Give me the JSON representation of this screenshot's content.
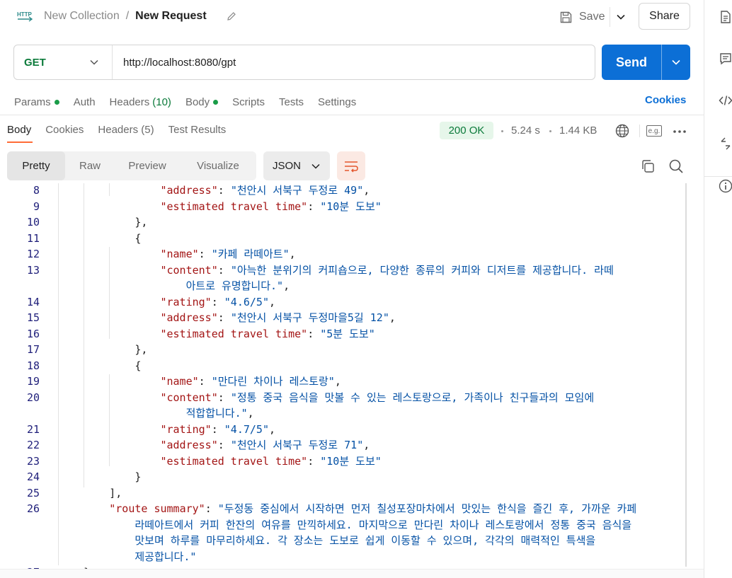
{
  "header": {
    "collection": "New Collection",
    "separator": "/",
    "request_name": "New Request",
    "save_label": "Save",
    "share_label": "Share"
  },
  "request": {
    "method": "GET",
    "url": "http://localhost:8080/gpt",
    "send_label": "Send"
  },
  "request_tabs": [
    {
      "label": "Params",
      "dot": true
    },
    {
      "label": "Auth"
    },
    {
      "label": "Headers",
      "count": "(10)"
    },
    {
      "label": "Body",
      "dot": true
    },
    {
      "label": "Scripts"
    },
    {
      "label": "Tests"
    },
    {
      "label": "Settings"
    }
  ],
  "cookies_link": "Cookies",
  "response": {
    "tabs": [
      {
        "label": "Body",
        "active": true
      },
      {
        "label": "Cookies"
      },
      {
        "label": "Headers (5)"
      },
      {
        "label": "Test Results"
      }
    ],
    "status": "200 OK",
    "time": "5.24 s",
    "size": "1.44 KB",
    "example_icon_text": "e.g."
  },
  "format": {
    "modes": [
      "Pretty",
      "Raw",
      "Preview",
      "Visualize"
    ],
    "active_mode": "Pretty",
    "language": "JSON"
  },
  "icons": {
    "http": "http-icon",
    "edit": "pencil-icon",
    "save": "save-icon",
    "wrap": "wrap-lines-icon",
    "copy": "copy-icon",
    "search": "search-icon",
    "globe": "globe-icon",
    "more": "more-icon",
    "rail": [
      "documentation-icon",
      "comments-icon",
      "code-icon",
      "related-icon",
      "info-icon"
    ]
  },
  "colors": {
    "send": "#0c6fd6",
    "method": "#0b7a3a",
    "status_bg": "#e6f6ea",
    "tab_accent": "#ff6c37",
    "json_key": "#a31515",
    "json_string": "#0451a5"
  },
  "code_lines": [
    {
      "n": "8",
      "indent": 5,
      "segs": [
        [
          "k",
          "\"address\""
        ],
        [
          "p",
          ": "
        ],
        [
          "s",
          "\"천안시 서북구 두정로 49\""
        ],
        [
          "p",
          ","
        ]
      ]
    },
    {
      "n": "9",
      "indent": 5,
      "segs": [
        [
          "k",
          "\"estimated travel time\""
        ],
        [
          "p",
          ": "
        ],
        [
          "s",
          "\"10분 도보\""
        ]
      ]
    },
    {
      "n": "10",
      "indent": 4,
      "segs": [
        [
          "p",
          "},"
        ]
      ]
    },
    {
      "n": "11",
      "indent": 4,
      "segs": [
        [
          "p",
          "{"
        ]
      ]
    },
    {
      "n": "12",
      "indent": 5,
      "segs": [
        [
          "k",
          "\"name\""
        ],
        [
          "p",
          ": "
        ],
        [
          "s",
          "\"카페 라떼아트\""
        ],
        [
          "p",
          ","
        ]
      ]
    },
    {
      "n": "13",
      "indent": 5,
      "segs": [
        [
          "k",
          "\"content\""
        ],
        [
          "p",
          ": "
        ],
        [
          "s",
          "\"아늑한 분위기의 커피숍으로, 다양한 종류의 커피와 디저트를 제공합니다. 라떼"
        ]
      ]
    },
    {
      "n": "",
      "indent": 6,
      "segs": [
        [
          "s",
          "아트로 유명합니다.\""
        ],
        [
          "p",
          ","
        ]
      ]
    },
    {
      "n": "14",
      "indent": 5,
      "segs": [
        [
          "k",
          "\"rating\""
        ],
        [
          "p",
          ": "
        ],
        [
          "s",
          "\"4.6/5\""
        ],
        [
          "p",
          ","
        ]
      ]
    },
    {
      "n": "15",
      "indent": 5,
      "segs": [
        [
          "k",
          "\"address\""
        ],
        [
          "p",
          ": "
        ],
        [
          "s",
          "\"천안시 서북구 두정마을5길 12\""
        ],
        [
          "p",
          ","
        ]
      ]
    },
    {
      "n": "16",
      "indent": 5,
      "segs": [
        [
          "k",
          "\"estimated travel time\""
        ],
        [
          "p",
          ": "
        ],
        [
          "s",
          "\"5분 도보\""
        ]
      ]
    },
    {
      "n": "17",
      "indent": 4,
      "segs": [
        [
          "p",
          "},"
        ]
      ]
    },
    {
      "n": "18",
      "indent": 4,
      "segs": [
        [
          "p",
          "{"
        ]
      ]
    },
    {
      "n": "19",
      "indent": 5,
      "segs": [
        [
          "k",
          "\"name\""
        ],
        [
          "p",
          ": "
        ],
        [
          "s",
          "\"만다린 차이나 레스토랑\""
        ],
        [
          "p",
          ","
        ]
      ]
    },
    {
      "n": "20",
      "indent": 5,
      "segs": [
        [
          "k",
          "\"content\""
        ],
        [
          "p",
          ": "
        ],
        [
          "s",
          "\"정통 중국 음식을 맛볼 수 있는 레스토랑으로, 가족이나 친구들과의 모임에"
        ]
      ]
    },
    {
      "n": "",
      "indent": 6,
      "segs": [
        [
          "s",
          "적합합니다.\""
        ],
        [
          "p",
          ","
        ]
      ]
    },
    {
      "n": "21",
      "indent": 5,
      "segs": [
        [
          "k",
          "\"rating\""
        ],
        [
          "p",
          ": "
        ],
        [
          "s",
          "\"4.7/5\""
        ],
        [
          "p",
          ","
        ]
      ]
    },
    {
      "n": "22",
      "indent": 5,
      "segs": [
        [
          "k",
          "\"address\""
        ],
        [
          "p",
          ": "
        ],
        [
          "s",
          "\"천안시 서북구 두정로 71\""
        ],
        [
          "p",
          ","
        ]
      ]
    },
    {
      "n": "23",
      "indent": 5,
      "segs": [
        [
          "k",
          "\"estimated travel time\""
        ],
        [
          "p",
          ": "
        ],
        [
          "s",
          "\"10분 도보\""
        ]
      ]
    },
    {
      "n": "24",
      "indent": 4,
      "segs": [
        [
          "p",
          "}"
        ]
      ]
    },
    {
      "n": "25",
      "indent": 3,
      "segs": [
        [
          "p",
          "],"
        ]
      ]
    },
    {
      "n": "26",
      "indent": 3,
      "segs": [
        [
          "k",
          "\"route summary\""
        ],
        [
          "p",
          ": "
        ],
        [
          "s",
          "\"두정동 중심에서 시작하면 먼저 칠성포장마차에서 맛있는 한식을 즐긴 후, 가까운 카페"
        ]
      ]
    },
    {
      "n": "",
      "indent": 4,
      "segs": [
        [
          "s",
          "라떼아트에서 커피 한잔의 여유를 만끽하세요. 마지막으로 만다린 차이나 레스토랑에서 정통 중국 음식을"
        ]
      ]
    },
    {
      "n": "",
      "indent": 4,
      "segs": [
        [
          "s",
          "맛보며 하루를 마무리하세요. 각 장소는 도보로 쉽게 이동할 수 있으며, 각각의 매력적인 특색을"
        ]
      ]
    },
    {
      "n": "",
      "indent": 4,
      "segs": [
        [
          "s",
          "제공합니다.\""
        ]
      ]
    },
    {
      "n": "27",
      "indent": 2,
      "segs": [
        [
          "p",
          "}"
        ]
      ]
    }
  ]
}
